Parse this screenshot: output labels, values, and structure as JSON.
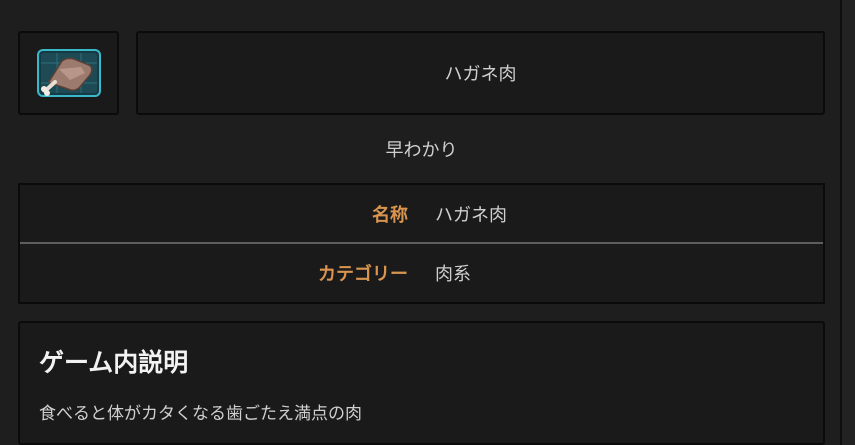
{
  "item": {
    "icon": "steel-meat-icon",
    "name": "ハガネ肉"
  },
  "quick_summary": {
    "heading": "早わかり",
    "rows": [
      {
        "label": "名称",
        "value": "ハガネ肉"
      },
      {
        "label": "カテゴリー",
        "value": "肉系"
      }
    ]
  },
  "description": {
    "heading": "ゲーム内説明",
    "text": "食べると体がカタくなる歯ごたえ満点の肉"
  },
  "colors": {
    "background": "#1e1e1e",
    "panel": "#1a1a1a",
    "label_accent": "#d9954f",
    "text": "#cfcfcf",
    "icon_frame": "#3ab7c9"
  }
}
